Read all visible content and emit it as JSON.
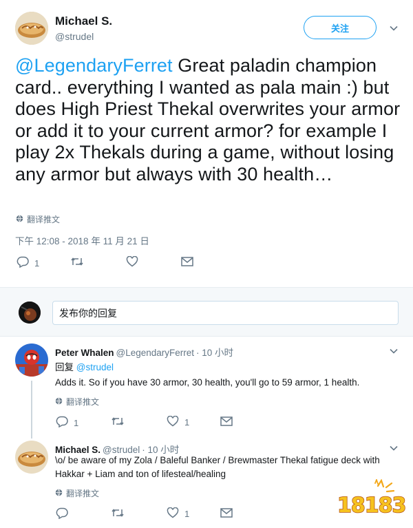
{
  "main_tweet": {
    "author_name": "Michael S.",
    "author_handle": "@strudel",
    "follow_label": "关注",
    "mention": "@LegendaryFerret",
    "body": " Great paladin champion card.. everything I wanted as pala main :) but does High Priest Thekal overwrites your armor or add it to your current armor? for example I play 2x Thekals during a game, without losing any armor but always with 30 health…",
    "translate_label": "翻译推文",
    "timestamp": "下午 12:08 - 2018 年 11 月 21 日",
    "actions": {
      "reply_count": "1",
      "retweet_count": "",
      "like_count": ""
    }
  },
  "reply_box": {
    "placeholder": "发布你的回复"
  },
  "replies": [
    {
      "author_name": "Peter Whalen",
      "author_handle": "@LegendaryFerret",
      "time": "· 10 小时",
      "reply_to_label": "回复",
      "reply_to_handle": "@strudel",
      "body": "Adds it.  So if you have 30 armor, 30 health, you'll go to 59 armor, 1 health.",
      "translate_label": "翻译推文",
      "reply_count": "1",
      "like_count": "1"
    },
    {
      "author_name": "Michael S.",
      "author_handle": "@strudel",
      "time": "· 10 小时",
      "body": "\\o/ be aware of my Zola / Baleful Banker / Brewmaster Thekal fatigue deck with Hakkar + Liam and ton of lifesteal/healing",
      "translate_label": "翻译推文",
      "reply_count": "",
      "like_count": "1"
    }
  ],
  "watermark": {
    "text": "18183"
  },
  "colors": {
    "accent": "#1da1f2",
    "muted": "#657786",
    "text": "#14171a",
    "divider": "#e6ecf0"
  }
}
